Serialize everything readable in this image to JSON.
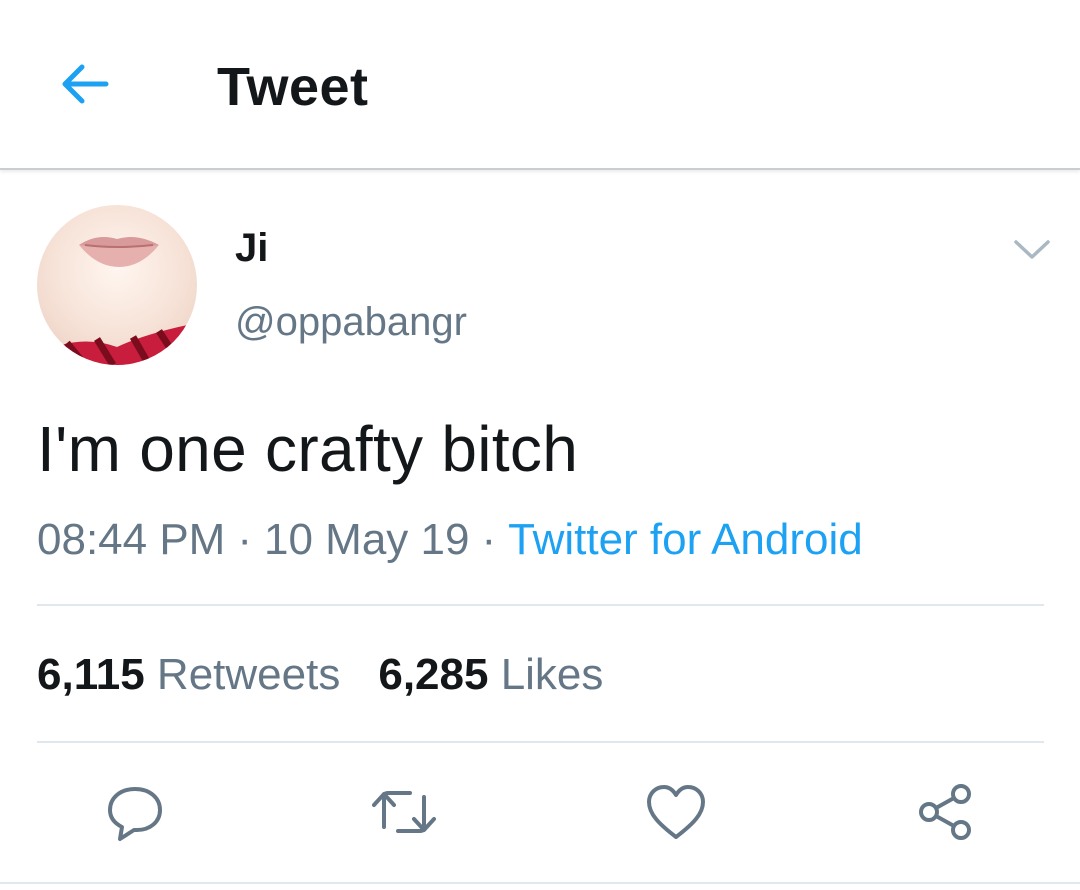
{
  "header": {
    "title": "Tweet",
    "back_icon": "arrow-left-icon",
    "accent": "#1da1f2"
  },
  "tweet": {
    "author_name": "Ji",
    "author_handle": "@oppabangr",
    "text": "I'm one crafty bitch",
    "time": "08:44 PM",
    "date": "10 May 19",
    "separator": "·",
    "source": "Twitter for Android",
    "more_icon": "chevron-down-icon"
  },
  "stats": {
    "retweets_count": "6,115",
    "retweets_label": "Retweets",
    "likes_count": "6,285",
    "likes_label": "Likes"
  },
  "actions": [
    {
      "icon": "reply-icon"
    },
    {
      "icon": "retweet-icon"
    },
    {
      "icon": "like-icon"
    },
    {
      "icon": "share-icon"
    }
  ],
  "colors": {
    "text": "#14171a",
    "secondary": "#657786",
    "link": "#1da1f2",
    "divider": "#e1e8ed"
  }
}
